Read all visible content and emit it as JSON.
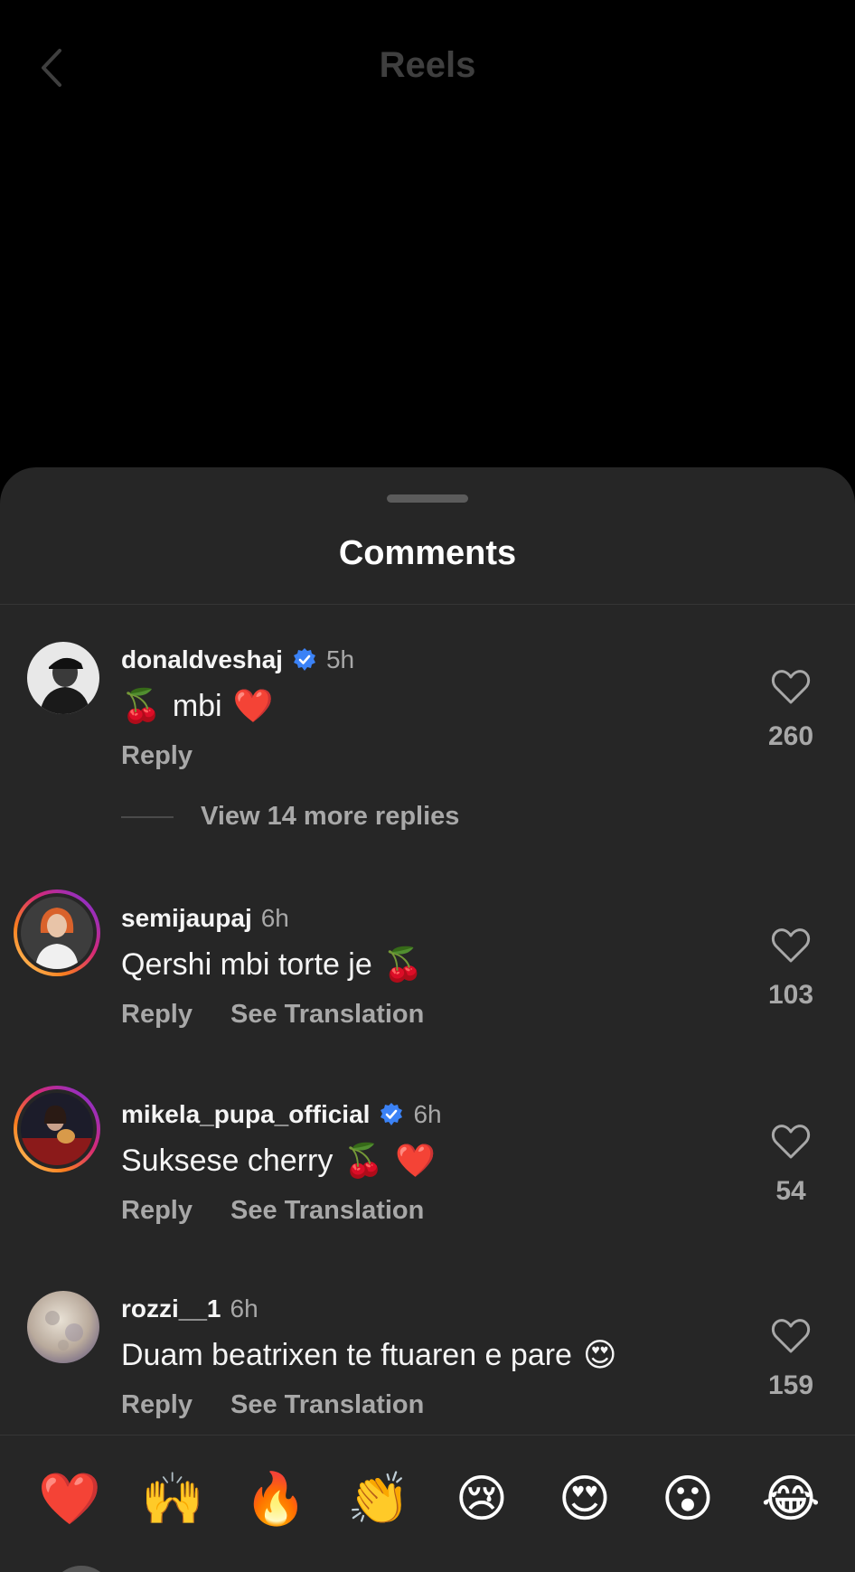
{
  "header": {
    "title": "Reels"
  },
  "sheet": {
    "title": "Comments"
  },
  "comments": [
    {
      "username": "donaldveshaj",
      "verified": true,
      "time": "5h",
      "text_before": "🍒",
      "text": "mbi",
      "text_after": "❤️",
      "reply_label": "Reply",
      "likes": "260"
    },
    {
      "username": "semijaupaj",
      "verified": false,
      "time": "6h",
      "text": "Qershi mbi torte je",
      "text_after": "🍒",
      "reply_label": "Reply",
      "translate_label": "See Translation",
      "likes": "103"
    },
    {
      "username": "mikela_pupa_official",
      "verified": true,
      "time": "6h",
      "text": "Suksese cherry",
      "text_after": "🍒",
      "text_after2": "❤️",
      "reply_label": "Reply",
      "translate_label": "See Translation",
      "likes": "54"
    },
    {
      "username": "rozzi__1",
      "verified": false,
      "time": "6h",
      "text": "Duam beatrixen te ftuaren e pare",
      "text_after": "😍",
      "reply_label": "Reply",
      "translate_label": "See Translation",
      "likes": "159"
    }
  ],
  "view_more_replies": "View 14 more replies",
  "quick_reactions": [
    "❤️",
    "🙌",
    "🔥",
    "👏",
    "😢",
    "😍",
    "😮",
    "😂"
  ],
  "colors": {
    "sheet_bg": "#262626",
    "verified": "#3b82f6",
    "muted_text": "#a8a8a8"
  }
}
